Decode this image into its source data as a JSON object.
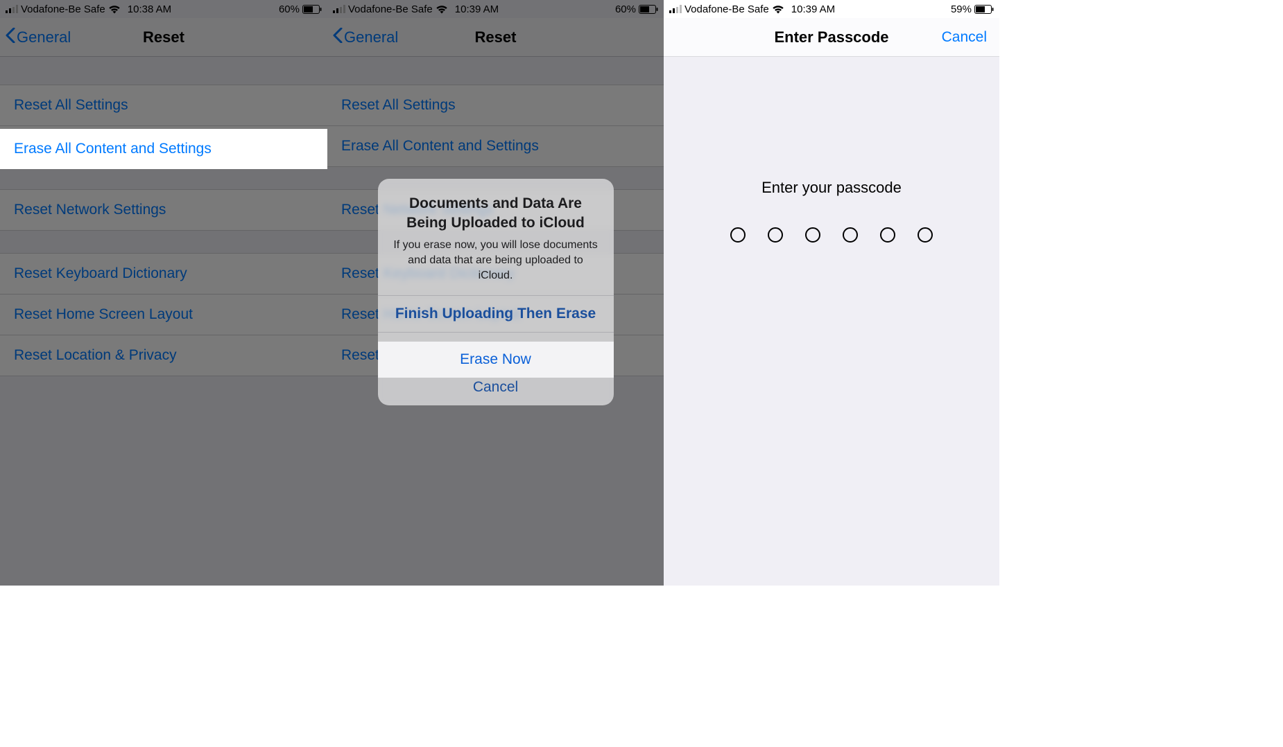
{
  "screen1": {
    "status": {
      "carrier": "Vodafone-Be Safe",
      "time": "10:38 AM",
      "battery": "60%"
    },
    "nav": {
      "back": "General",
      "title": "Reset"
    },
    "items": {
      "reset_all": "Reset All Settings",
      "erase_all": "Erase All Content and Settings",
      "reset_network": "Reset Network Settings",
      "reset_keyboard": "Reset Keyboard Dictionary",
      "reset_home": "Reset Home Screen Layout",
      "reset_location": "Reset Location & Privacy"
    }
  },
  "screen2": {
    "status": {
      "carrier": "Vodafone-Be Safe",
      "time": "10:39 AM",
      "battery": "60%"
    },
    "nav": {
      "back": "General",
      "title": "Reset"
    },
    "items": {
      "reset_all": "Reset All Settings",
      "erase_all": "Erase All Content and Settings",
      "reset_network": "Reset Network Settings",
      "reset_keyboard": "Reset Keyboard Dictionary",
      "reset_home": "Reset Home Screen Layout",
      "reset_location": "Reset Location & Privacy"
    },
    "alert": {
      "title": "Documents and Data Are Being Uploaded to iCloud",
      "message": "If you erase now, you will lose documents and data that are being uploaded to iCloud.",
      "finish": "Finish Uploading Then Erase",
      "erase_now": "Erase Now",
      "cancel": "Cancel"
    }
  },
  "screen3": {
    "status": {
      "carrier": "Vodafone-Be Safe",
      "time": "10:39 AM",
      "battery": "59%"
    },
    "nav": {
      "title": "Enter Passcode",
      "cancel": "Cancel"
    },
    "prompt": "Enter your passcode"
  }
}
